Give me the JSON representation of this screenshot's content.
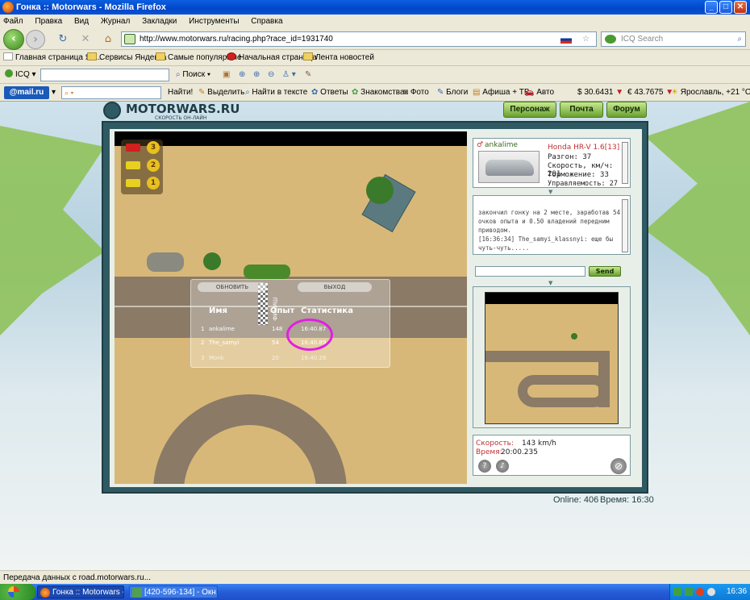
{
  "window": {
    "title": "Гонка :: Motorwars - Mozilla Firefox"
  },
  "menu": [
    "Файл",
    "Правка",
    "Вид",
    "Журнал",
    "Закладки",
    "Инструменты",
    "Справка"
  ],
  "nav": {
    "url": "http://www.motorwars.ru/racing.php?race_id=1931740",
    "search_placeholder": "ICQ Search"
  },
  "bookmarks": [
    "Главная страница Ян...",
    "Сервисы Яндекса",
    "Самые популярные",
    "Начальная страница",
    "Лента новостей"
  ],
  "icq_toolbar": {
    "icq_label": "ICQ",
    "search_label": "Поиск"
  },
  "mail_toolbar": {
    "logo": "@mail.ru",
    "find": "Найти!",
    "highlight": "Выделить",
    "find_in_text": "Найти в тексте",
    "items": [
      "Ответы",
      "Знакомства",
      "Фото",
      "Блоги",
      "Афиша + ТВ",
      "Авто"
    ],
    "usd": "$ 30.6431",
    "eur": "€ 43.7675",
    "weather": "Ярославль, +21 °C"
  },
  "site": {
    "logo": "MOTORWARS.RU",
    "tagline": "СКОРОСТЬ ОН-ЛАЙН",
    "tabs": [
      "Персонаж",
      "Почта",
      "Форум"
    ],
    "online_label": "Online: 406",
    "time_label": "Время: 16:30"
  },
  "race": {
    "positions": [
      "3",
      "2",
      "1"
    ],
    "refresh_button": "ОБНОВИТЬ",
    "exit_button": "ВЫХОД",
    "finish_text": "ФИНИШ",
    "columns": [
      "Имя",
      "Опыт",
      "Статистика"
    ],
    "results": [
      {
        "place": "1",
        "name": "ankalime",
        "exp": "148",
        "stat": "16:40.87"
      },
      {
        "place": "2",
        "name": "The_samyi",
        "exp": "54",
        "stat": "16:40.89"
      },
      {
        "place": "3",
        "name": "Monk",
        "exp": "20",
        "stat": "16:40.26"
      }
    ]
  },
  "player": {
    "name": "ankalime",
    "car": "Honda HR-V 1.6[13]",
    "stats": [
      "Разгон: 37",
      "Скорость, км/ч: 201",
      "Торможение: 33",
      "Управляемость: 27"
    ]
  },
  "chat": {
    "lines": [
      "закончил гонку на 2 месте, заработав 54",
      "очков опыта и 0.50 владений передним",
      "приводом.",
      "[16:36:34] The_samyi_klassnyi: еще бы",
      "чуть-чуть....."
    ],
    "send_label": "Send"
  },
  "hud": {
    "speed_label": "Скорость:",
    "speed_value": "143 km/h",
    "time_label": "Время:",
    "time_value": "20:00.235"
  },
  "status": {
    "text": "Передача данных с road.motorwars.ru..."
  },
  "taskbar": {
    "tasks": [
      "Гонка :: Motorwars -...",
      "[420-596-134] - Окн..."
    ],
    "clock": "16:36"
  }
}
